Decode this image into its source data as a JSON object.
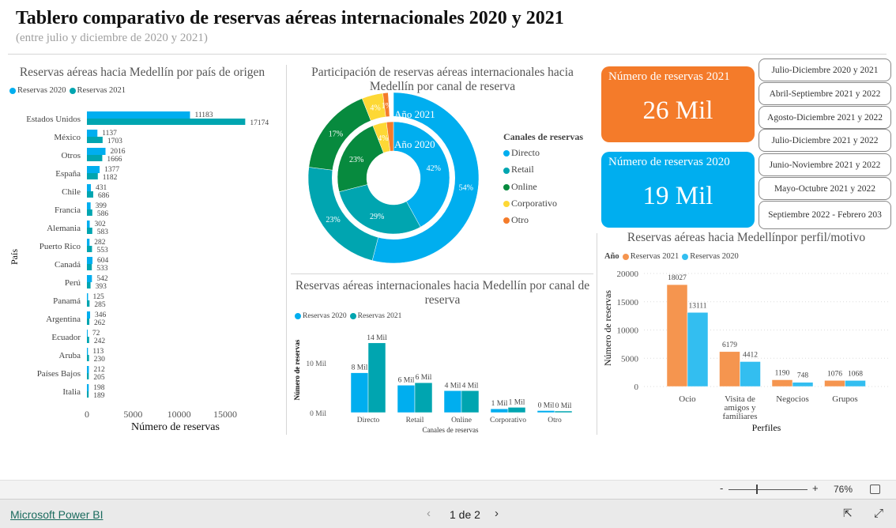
{
  "header": {
    "title": "Tablero comparativo de reservas aéreas internacionales 2020 y 2021",
    "subtitle": "(entre julio y diciembre de 2020 y 2021)"
  },
  "colors": {
    "r2020": "#00AEEF",
    "r2021": "#00A5B0",
    "directo": "#00AEEF",
    "retail": "#00A5B0",
    "online": "#078A3E",
    "corporativo": "#FDD835",
    "otro": "#F47B2A",
    "kpi2021": "#F47B2A",
    "kpi2020": "#00AEEF",
    "perfil2021": "#F5954F",
    "perfil2020": "#33BEF0"
  },
  "chart_data": [
    {
      "type": "bar",
      "orientation": "horizontal",
      "title": "Reservas aéreas hacia Medellín por país de origen",
      "xlabel": "Número de reservas",
      "ylabel": "País",
      "xlim": [
        0,
        17174
      ],
      "xticks": [
        "0",
        "5000",
        "10000",
        "15000"
      ],
      "legend": "top-left",
      "categories": [
        "Estados Unidos",
        "México",
        "Otros",
        "España",
        "Chile",
        "Francia",
        "Alemania",
        "Puerto Rico",
        "Canadá",
        "Perú",
        "Panamá",
        "Argentina",
        "Ecuador",
        "Aruba",
        "Países Bajos",
        "Italia"
      ],
      "series": [
        {
          "name": "Reservas 2020",
          "values": [
            11183,
            1137,
            2016,
            1377,
            431,
            399,
            302,
            282,
            604,
            542,
            125,
            346,
            72,
            113,
            212,
            198
          ]
        },
        {
          "name": "Reservas 2021",
          "values": [
            17174,
            1703,
            1666,
            1182,
            686,
            586,
            583,
            553,
            533,
            393,
            285,
            262,
            242,
            230,
            205,
            189
          ]
        }
      ]
    },
    {
      "type": "pie",
      "subtype": "nested-donut",
      "title": "Participación de reservas aéreas internacionales hacia Medellín por canal de reserva",
      "legend_title": "Canales de reservas",
      "legend": "right",
      "categories": [
        "Directo",
        "Retail",
        "Online",
        "Corporativo",
        "Otro"
      ],
      "series": [
        {
          "name": "Año 2021",
          "values": [
            54,
            23,
            17,
            4,
            1
          ],
          "labels": [
            "54%",
            "23%",
            "17%",
            "4%",
            "1%"
          ]
        },
        {
          "name": "Año 2020",
          "values": [
            42,
            29,
            23,
            4,
            2
          ],
          "labels": [
            "42%",
            "29%",
            "23%",
            "4%",
            ""
          ]
        }
      ]
    },
    {
      "type": "bar",
      "title": "Reservas aéreas internacionales hacia Medellín por canal de reserva",
      "xlabel": "Canales de reservas",
      "ylabel": "Número de reservas",
      "ylim": [
        0,
        14000
      ],
      "yticks": [
        "0 Mil",
        "10 Mil"
      ],
      "legend": "top-left",
      "categories": [
        "Directo",
        "Retail",
        "Online",
        "Corporativo",
        "Otro"
      ],
      "series": [
        {
          "name": "Reservas 2020",
          "values": [
            8000,
            5500,
            4400,
            760,
            400
          ],
          "labels": [
            "8 Mil",
            "6 Mil",
            "4 Mil",
            "1 Mil",
            "0 Mil"
          ]
        },
        {
          "name": "Reservas 2021",
          "values": [
            14000,
            6000,
            4400,
            1050,
            300
          ],
          "labels": [
            "14 Mil",
            "6 Mil",
            "4 Mil",
            "1 Mil",
            "0 Mil"
          ]
        }
      ]
    },
    {
      "type": "bar",
      "title": "Reservas aéreas hacia Medellínpor perfil/motivo",
      "xlabel": "Perfiles",
      "ylabel": "Número de reservas",
      "ylim": [
        0,
        20000
      ],
      "yticks": [
        "0",
        "5000",
        "10000",
        "15000",
        "20000"
      ],
      "grid": true,
      "legend_title": "Año",
      "legend": "top-left",
      "categories": [
        "Ocio",
        "Visita de amigos y familiares",
        "Negocios",
        "Grupos"
      ],
      "series": [
        {
          "name": "Reservas 2021",
          "values": [
            18027,
            6179,
            1190,
            1076
          ]
        },
        {
          "name": "Reservas 2020",
          "values": [
            13111,
            4412,
            748,
            1068
          ]
        }
      ]
    }
  ],
  "kpis": [
    {
      "label": "Número de reservas 2021",
      "value": "26 Mil"
    },
    {
      "label": "Número de reservas 2020",
      "value": "19 Mil"
    }
  ],
  "period_buttons": [
    "Julio-Diciembre 2020 y 2021",
    "Abril-Septiembre 2021 y 2022",
    "Agosto-Diciembre 2021 y 2022",
    "Julio-Diciembre 2021 y 2022",
    "Junio-Noviembre 2021 y 2022",
    "Mayo-Octubre 2021 y 2022",
    "Septiembre 2022 - Febrero 203"
  ],
  "zoom": {
    "minus": "-",
    "plus": "+",
    "level": "76%",
    "level_value": 76
  },
  "footer": {
    "brand": "Microsoft Power BI",
    "page": "1 de 2",
    "prev_icon": "chevron-left-icon",
    "next_icon": "chevron-right-icon",
    "share_icon": "share-icon",
    "fullscreen_icon": "expand-icon"
  }
}
